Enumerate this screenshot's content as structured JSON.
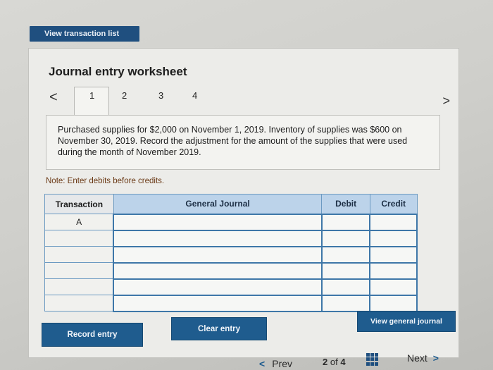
{
  "top": {
    "view_transaction_list": "View transaction list"
  },
  "worksheet": {
    "title": "Journal entry worksheet",
    "tabs": [
      "1",
      "2",
      "3",
      "4"
    ],
    "active_tab": "1",
    "question": "Purchased supplies for $2,000 on November 1, 2019. Inventory of supplies was $600 on November 30, 2019. Record the adjustment for the amount of the supplies that were used during the month of November 2019.",
    "note": "Note: Enter debits before credits."
  },
  "table": {
    "headers": [
      "Transaction",
      "General Journal",
      "Debit",
      "Credit"
    ],
    "rows": [
      [
        "A",
        "",
        "",
        ""
      ],
      [
        "",
        "",
        "",
        ""
      ],
      [
        "",
        "",
        "",
        ""
      ],
      [
        "",
        "",
        "",
        ""
      ],
      [
        "",
        "",
        "",
        ""
      ],
      [
        "",
        "",
        "",
        ""
      ]
    ]
  },
  "buttons": {
    "record_entry": "Record entry",
    "clear_entry": "Clear entry",
    "view_general_journal": "View general journal"
  },
  "pager": {
    "prev": "Prev",
    "current": "2",
    "of": "of",
    "total": "4",
    "next": "Next"
  },
  "colors": {
    "primary_button": "#1f5c8e",
    "table_header": "#bcd3ea",
    "note_text": "#6b3a16"
  }
}
